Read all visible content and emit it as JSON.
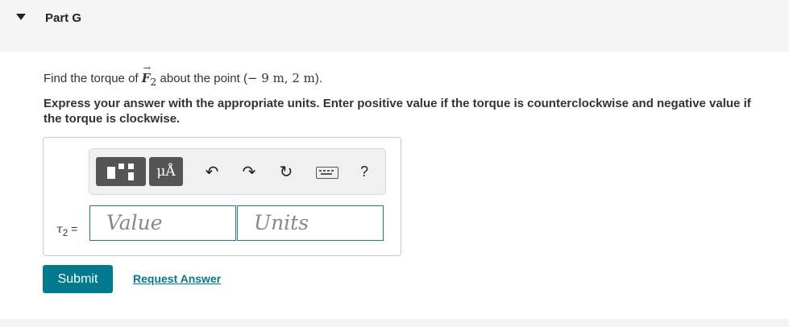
{
  "part": {
    "title": "Part G"
  },
  "question": {
    "prefix": "Find the torque of ",
    "vector_letter": "F",
    "vector_subscript": "2",
    "suffix": " about the point (",
    "point": "− 9 m, 2 m",
    "close": ")."
  },
  "instructions": "Express your answer with the appropriate units. Enter positive value if the torque is counterclockwise and negative value if the torque is clockwise.",
  "answer": {
    "label_symbol": "τ",
    "label_subscript": "2",
    "label_equals": " =",
    "value_placeholder": "Value",
    "units_placeholder": "Units"
  },
  "toolbar": {
    "units_button": "μÅ",
    "undo": "↶",
    "redo": "↷",
    "reset": "↻",
    "help": "?",
    "icons": [
      "template-icon",
      "units-icon",
      "undo-icon",
      "redo-icon",
      "reset-icon",
      "keyboard-icon",
      "help-icon"
    ]
  },
  "actions": {
    "submit": "Submit",
    "request_answer": "Request Answer"
  },
  "colors": {
    "accent": "#007a8c",
    "field_border": "#1d7a8c",
    "header_bg": "#f5f5f5"
  }
}
